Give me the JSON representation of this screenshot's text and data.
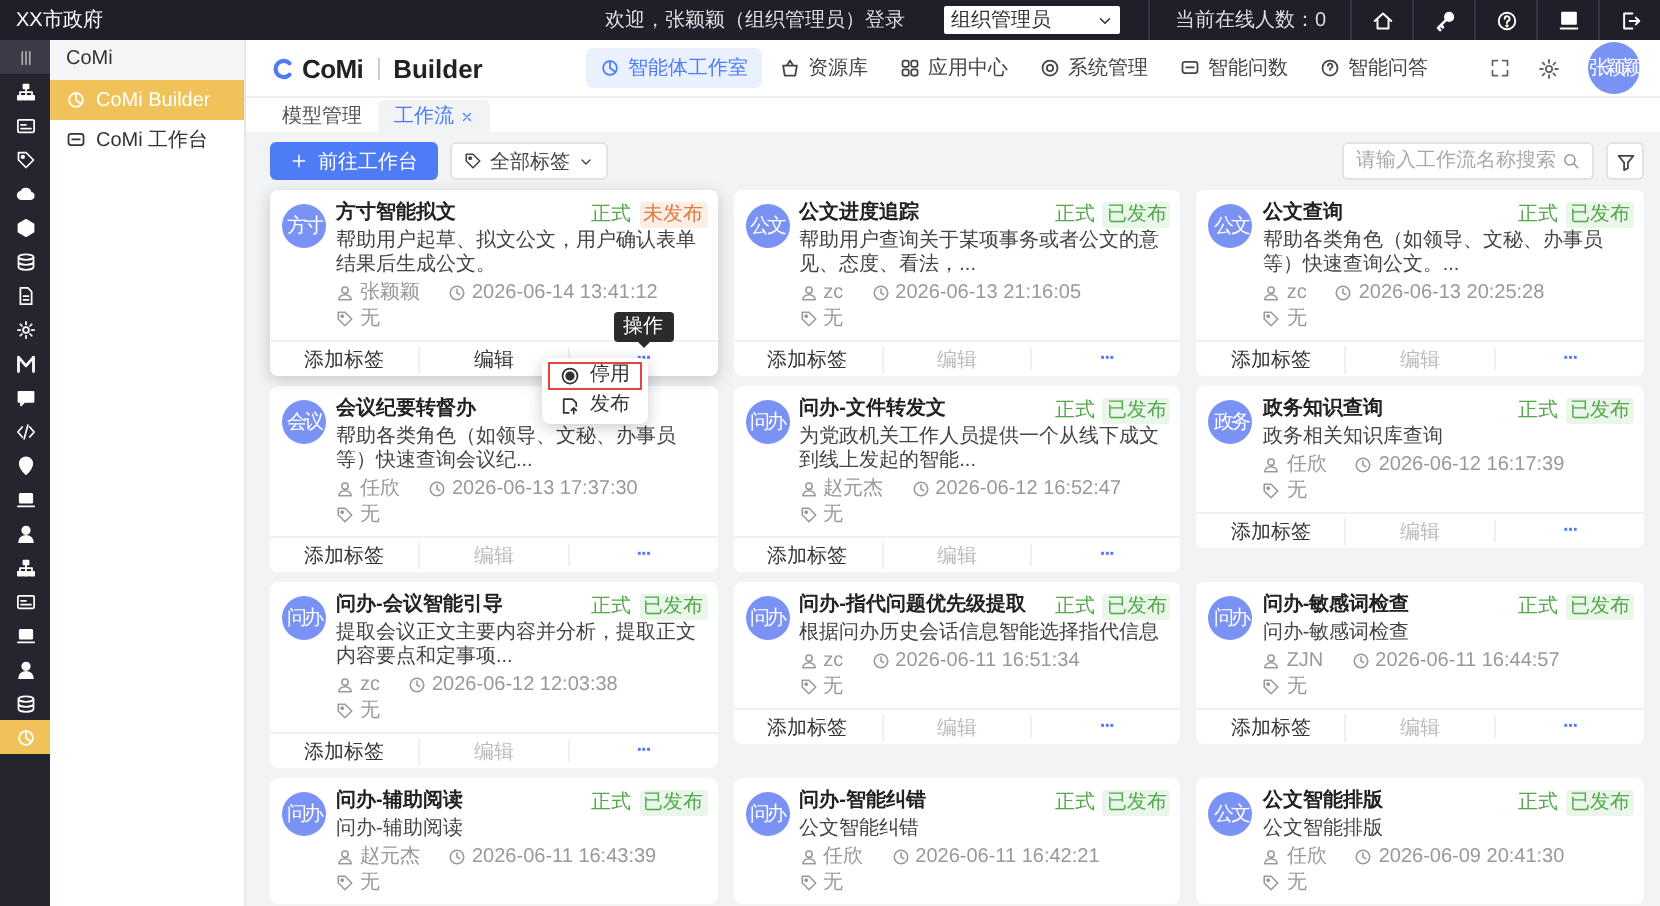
{
  "topbar": {
    "org": "XX市政府",
    "welcome": "欢迎，张颖颖（组织管理员）登录",
    "role_select": {
      "value": "组织管理员"
    },
    "online": "当前在线人数：0"
  },
  "rail": [
    {
      "selected": false
    },
    {
      "selected": false
    },
    {
      "selected": false
    },
    {
      "selected": false
    },
    {
      "selected": false
    },
    {
      "selected": false
    },
    {
      "selected": false
    },
    {
      "selected": false
    },
    {
      "selected": false
    },
    {
      "selected": false
    },
    {
      "selected": false
    },
    {
      "selected": false
    },
    {
      "selected": false
    },
    {
      "selected": false
    },
    {
      "selected": false
    },
    {
      "selected": false
    },
    {
      "selected": false
    },
    {
      "selected": false
    },
    {
      "selected": false
    },
    {
      "selected": true
    }
  ],
  "submenu": {
    "title": "CoMi",
    "items": [
      {
        "label": "CoMi Builder",
        "selected": true
      },
      {
        "label": "CoMi 工作台",
        "selected": false
      }
    ]
  },
  "header": {
    "brand": "CoMi",
    "product": "Builder",
    "nav": [
      {
        "label": "智能体工作室",
        "selected": true
      },
      {
        "label": "资源库",
        "selected": false
      },
      {
        "label": "应用中心",
        "selected": false
      },
      {
        "label": "系统管理",
        "selected": false
      },
      {
        "label": "智能问数",
        "selected": false
      },
      {
        "label": "智能问答",
        "selected": false
      }
    ],
    "user": "张颖颖"
  },
  "tabs": [
    {
      "label": "模型管理",
      "selected": false,
      "closable": false
    },
    {
      "label": "工作流",
      "selected": true,
      "closable": true
    }
  ],
  "toolbar": {
    "primary": "前往工作台",
    "tag_filter": "全部标签",
    "search": {
      "placeholder": "请输入工作流名称搜索"
    }
  },
  "cards": [
    {
      "avatar": "方寸",
      "title": "方寸智能拟文",
      "highlighted": true,
      "badges": [
        {
          "label": "正式",
          "kind": "type"
        },
        {
          "label": "未发布",
          "kind": "unpublished"
        }
      ],
      "desc": "帮助用户起草、拟文公文，用户确认表单结果后生成公文。",
      "author": "张颖颖",
      "time": "2026-06-14 13:41:12",
      "tags": "无",
      "actions": {
        "add_tag": "添加标签",
        "edit": "编辑",
        "edit_disabled": false,
        "more": "···"
      },
      "more_menu": {
        "tooltip": "操作",
        "items": [
          {
            "label": "停用",
            "kind": "disable",
            "selected": true
          },
          {
            "label": "发布",
            "kind": "publish",
            "selected": false
          }
        ]
      }
    },
    {
      "avatar": "公文",
      "title": "公文进度追踪",
      "highlighted": false,
      "badges": [
        {
          "label": "正式",
          "kind": "type"
        },
        {
          "label": "已发布",
          "kind": "published"
        }
      ],
      "desc": "帮助用户查询关于某项事务或者公文的意见、态度、看法，...",
      "author": "zc",
      "time": "2026-06-13 21:16:05",
      "tags": "无",
      "actions": {
        "add_tag": "添加标签",
        "edit": "编辑",
        "edit_disabled": true,
        "more": "···"
      }
    },
    {
      "avatar": "公文",
      "title": "公文查询",
      "highlighted": false,
      "badges": [
        {
          "label": "正式",
          "kind": "type"
        },
        {
          "label": "已发布",
          "kind": "published"
        }
      ],
      "desc": "帮助各类角色（如领导、文秘、办事员等）快速查询公文。...",
      "author": "zc",
      "time": "2026-06-13 20:25:28",
      "tags": "无",
      "actions": {
        "add_tag": "添加标签",
        "edit": "编辑",
        "edit_disabled": true,
        "more": "···"
      }
    },
    {
      "avatar": "会议",
      "title": "会议纪要转督办",
      "highlighted": false,
      "desc": "帮助各类角色（如领导、文秘、办事员等）快速查询会议纪...",
      "author": "任欣",
      "time": "2026-06-13 17:37:30",
      "tags": "无",
      "actions": {
        "add_tag": "添加标签",
        "edit": "编辑",
        "edit_disabled": true,
        "more": "···"
      }
    },
    {
      "avatar": "问办",
      "title": "问办-文件转发文",
      "highlighted": false,
      "badges": [
        {
          "label": "正式",
          "kind": "type"
        },
        {
          "label": "已发布",
          "kind": "published"
        }
      ],
      "desc": "为党政机关工作人员提供一个从线下成文到线上发起的智能...",
      "author": "赵元杰",
      "time": "2026-06-12 16:52:47",
      "tags": "无",
      "actions": {
        "add_tag": "添加标签",
        "edit": "编辑",
        "edit_disabled": true,
        "more": "···"
      }
    },
    {
      "avatar": "政务",
      "title": "政务知识查询",
      "highlighted": false,
      "badges": [
        {
          "label": "正式",
          "kind": "type"
        },
        {
          "label": "已发布",
          "kind": "published"
        }
      ],
      "desc": "政务相关知识库查询",
      "author": "任欣",
      "time": "2026-06-12 16:17:39",
      "tags": "无",
      "actions": {
        "add_tag": "添加标签",
        "edit": "编辑",
        "edit_disabled": true,
        "more": "···"
      }
    },
    {
      "avatar": "问办",
      "title": "问办-会议智能引导",
      "highlighted": false,
      "badges": [
        {
          "label": "正式",
          "kind": "type"
        },
        {
          "label": "已发布",
          "kind": "published"
        }
      ],
      "desc": "提取会议正文主要内容并分析，提取正文内容要点和定事项...",
      "author": "zc",
      "time": "2026-06-12 12:03:38",
      "tags": "无",
      "actions": {
        "add_tag": "添加标签",
        "edit": "编辑",
        "edit_disabled": true,
        "more": "···"
      }
    },
    {
      "avatar": "问办",
      "title": "问办-指代问题优先级提取",
      "highlighted": false,
      "badges": [
        {
          "label": "正式",
          "kind": "type"
        },
        {
          "label": "已发布",
          "kind": "published"
        }
      ],
      "desc": "根据问办历史会话信息智能选择指代信息",
      "author": "zc",
      "time": "2026-06-11 16:51:34",
      "tags": "无",
      "actions": {
        "add_tag": "添加标签",
        "edit": "编辑",
        "edit_disabled": true,
        "more": "···"
      }
    },
    {
      "avatar": "问办",
      "title": "问办-敏感词检查",
      "highlighted": false,
      "badges": [
        {
          "label": "正式",
          "kind": "type"
        },
        {
          "label": "已发布",
          "kind": "published"
        }
      ],
      "desc": "问办-敏感词检查",
      "author": "ZJN",
      "time": "2026-06-11 16:44:57",
      "tags": "无",
      "actions": {
        "add_tag": "添加标签",
        "edit": "编辑",
        "edit_disabled": true,
        "more": "···"
      }
    },
    {
      "avatar": "问办",
      "title": "问办-辅助阅读",
      "highlighted": false,
      "badges": [
        {
          "label": "正式",
          "kind": "type"
        },
        {
          "label": "已发布",
          "kind": "published"
        }
      ],
      "desc": "问办-辅助阅读",
      "author": "赵元杰",
      "time": "2026-06-11 16:43:39",
      "tags": "无"
    },
    {
      "avatar": "问办",
      "title": "问办-智能纠错",
      "highlighted": false,
      "badges": [
        {
          "label": "正式",
          "kind": "type"
        },
        {
          "label": "已发布",
          "kind": "published"
        }
      ],
      "desc": "公文智能纠错",
      "author": "任欣",
      "time": "2026-06-11 16:42:21",
      "tags": "无"
    },
    {
      "avatar": "公文",
      "title": "公文智能排版",
      "highlighted": false,
      "badges": [
        {
          "label": "正式",
          "kind": "type"
        },
        {
          "label": "已发布",
          "kind": "published"
        }
      ],
      "desc": "公文智能排版",
      "author": "任欣",
      "time": "2026-06-09 20:41:30",
      "tags": "无"
    }
  ]
}
